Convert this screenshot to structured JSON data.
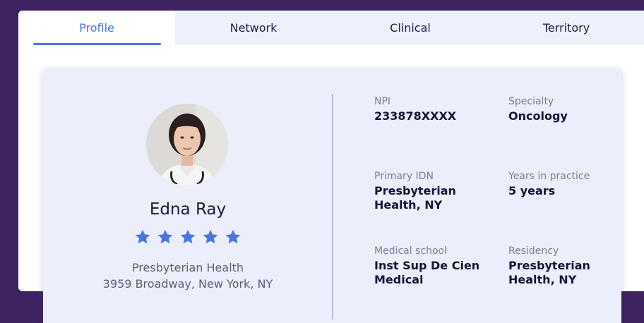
{
  "tabs": [
    {
      "label": "Profile"
    },
    {
      "label": "Network"
    },
    {
      "label": "Clinical"
    },
    {
      "label": "Territory"
    }
  ],
  "profile": {
    "name": "Edna Ray",
    "rating": 5,
    "rating_max": 5,
    "organization": "Presbyterian Health",
    "address": "3959 Broadway, New York, NY"
  },
  "details": [
    {
      "label": "NPI",
      "value": "233878XXXX"
    },
    {
      "label": "Specialty",
      "value": "Oncology"
    },
    {
      "label": "Primary IDN",
      "value": "Presbyterian Health, NY"
    },
    {
      "label": "Years in practice",
      "value": "5 years"
    },
    {
      "label": "Medical school",
      "value": "Inst Sup De Cien Medical"
    },
    {
      "label": "Residency",
      "value": "Presbyterian Health, NY"
    }
  ],
  "colors": {
    "accent": "#4a76e3",
    "background": "#3d2460",
    "card": "#eceefb"
  }
}
